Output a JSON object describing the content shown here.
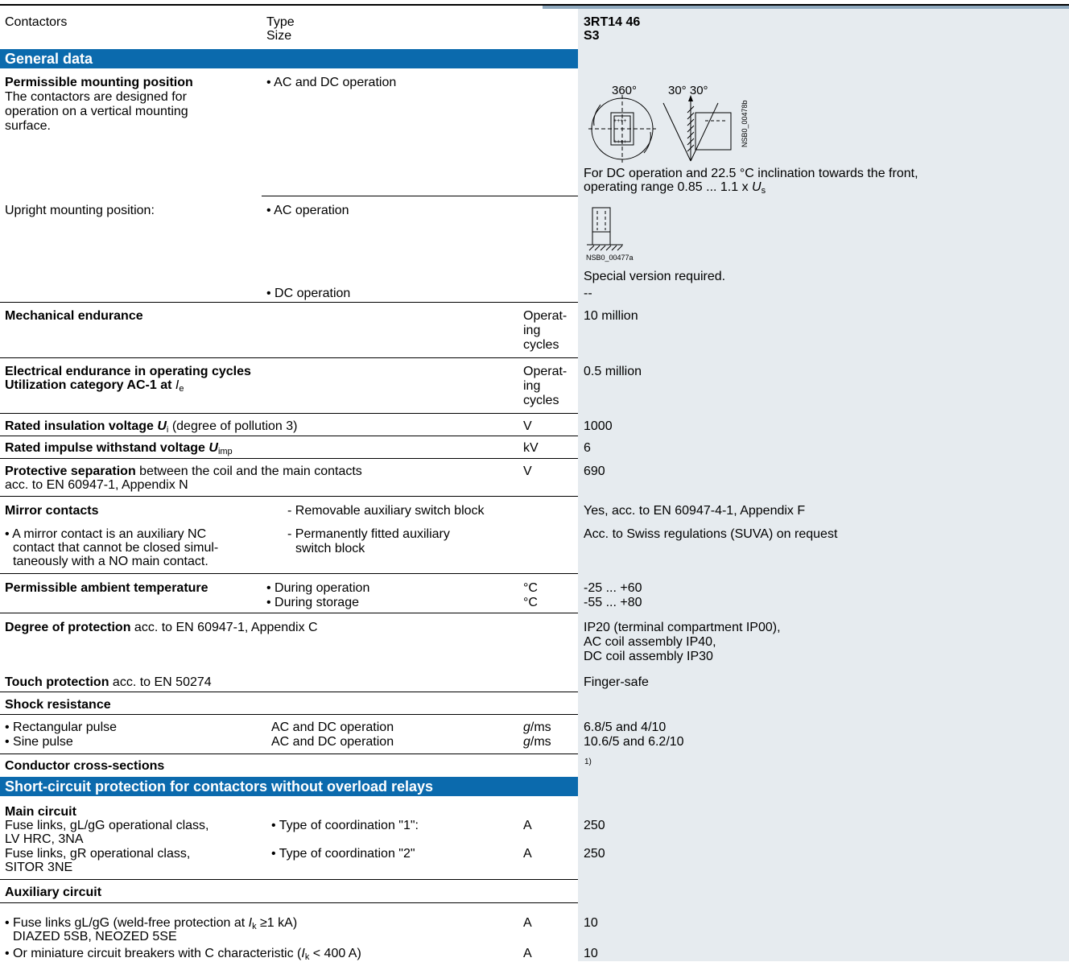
{
  "header": {
    "col1": "Contactors",
    "type_label": "Type",
    "size_label": "Size",
    "type_value": "3RT14 46",
    "size_value": "S3"
  },
  "sections": {
    "general": "General data",
    "short_circuit": "Short-circuit protection for contactors without overload relays"
  },
  "mounting": {
    "title": "Permissible mounting position",
    "desc": [
      "The contactors are designed for",
      "operation on a vertical mounting",
      "surface."
    ],
    "op": "• AC and DC operation",
    "fig1": {
      "a360": "360°",
      "a30": "30° 30°",
      "code": "NSB0_00478b"
    },
    "note1": "For DC operation and 22.5 °C inclination towards the front,",
    "note2_pre": "operating range 0.85 ... 1.1 x ",
    "note2_u": "U",
    "note2_sub": "s"
  },
  "upright": {
    "label": "Upright mounting position:",
    "ac": "• AC operation",
    "dc": "• DC operation",
    "fig_code": "NSB0_00477a",
    "ac_value": "Special version required.",
    "dc_value": "--"
  },
  "mech": {
    "label": "Mechanical endurance",
    "unit": [
      "Operat-",
      "ing",
      "cycles"
    ],
    "value": "10 million"
  },
  "elec": {
    "label1": "Electrical endurance in operating cycles",
    "label2": "Utilization category AC-1 at ",
    "label2_i": "I",
    "label2_sub": "e",
    "unit": [
      "Operat-",
      "ing",
      "cycles"
    ],
    "value": "0.5 million"
  },
  "ins": {
    "label_b": "Rated insulation voltage ",
    "u": "U",
    "sub": "i",
    "rest": " (degree of pollution 3)",
    "unit": "V",
    "value": "1000"
  },
  "imp": {
    "label_b": "Rated impulse withstand voltage ",
    "u": "U",
    "sub": "imp",
    "unit": "kV",
    "value": "6"
  },
  "sep": {
    "label_b": "Protective separation",
    "rest": " between the coil and the main contacts",
    "line2": "acc. to EN 60947-1, Appendix N",
    "unit": "V",
    "value": "690"
  },
  "mirror": {
    "title": "Mirror contacts",
    "desc": [
      "• A mirror contact is an auxiliary NC",
      "contact that cannot be closed simul-",
      "taneously with a NO main contact."
    ],
    "opt1": "- Removable auxiliary switch block",
    "opt2a": "- Permanently fitted auxiliary",
    "opt2b": "switch block",
    "val1": "Yes, acc. to EN 60947-4-1, Appendix F",
    "val2": "Acc. to Swiss regulations (SUVA) on request"
  },
  "ambient": {
    "label": "Permissible ambient temperature",
    "op": "• During operation",
    "st": "• During storage",
    "unit": "°C",
    "v_op": "-25 ... +60",
    "v_st": "-55 ... +80"
  },
  "protection": {
    "label_b": "Degree of protection",
    "rest": " acc. to EN 60947-1, Appendix C",
    "values": [
      "IP20 (terminal compartment IP00),",
      "AC coil assembly IP40,",
      "DC coil assembly IP30"
    ]
  },
  "touch": {
    "label_b": "Touch protection",
    "rest": " acc. to EN 50274",
    "value": "Finger-safe"
  },
  "shock": {
    "title": "Shock resistance",
    "rect": "• Rectangular pulse",
    "sine": "• Sine pulse",
    "op": "AC and DC operation",
    "unit_g": "g",
    "unit_rest": "/ms",
    "v_rect": "6.8/5 and 4/10",
    "v_sine": "10.6/5 and 6.2/10"
  },
  "conductor": {
    "label": "Conductor cross-sections",
    "footnote": "1)"
  },
  "main_circuit": {
    "title": "Main circuit",
    "fuse1a": "Fuse links, gL/gG operational class,",
    "fuse1b": "LV HRC, 3NA",
    "fuse2a": "Fuse links, gR operational class,",
    "fuse2b": "SITOR 3NE",
    "coord1": "• Type of coordination \"1\":",
    "coord2": "• Type of coordination \"2\"",
    "unit": "A",
    "v1": "250",
    "v2": "250"
  },
  "aux_circuit": {
    "title": "Auxiliary circuit",
    "l1a": "• Fuse links gL/gG (weld-free protection at ",
    "l1_i": "I",
    "l1_sub": "k",
    "l1b": " ≥1 kA)",
    "l1c": "DIAZED 5SB, NEOZED 5SE",
    "l2a": "• Or miniature circuit breakers with C characteristic (",
    "l2_i": "I",
    "l2_sub": "k",
    "l2b": " < 400 A)",
    "unit": "A",
    "v1": "10",
    "v2": "10"
  }
}
